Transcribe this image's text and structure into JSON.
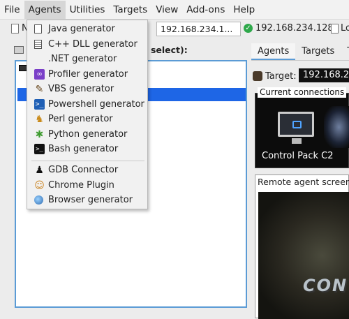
{
  "menubar": {
    "items": [
      {
        "label": "File"
      },
      {
        "label": "Agents"
      },
      {
        "label": "Utilities"
      },
      {
        "label": "Targets"
      },
      {
        "label": "View"
      },
      {
        "label": "Add-ons"
      },
      {
        "label": "Help"
      }
    ],
    "active": "Agents"
  },
  "toolbar": {
    "truncated_label": "N",
    "host_label": "o:",
    "host_value": "192.168.234.1...",
    "connected_ip": "192.168.234.128",
    "log_label": "Lo"
  },
  "left_panel": {
    "header": "o select):"
  },
  "right_panel": {
    "tabs": [
      {
        "label": "Agents"
      },
      {
        "label": "Targets"
      },
      {
        "label": "T"
      }
    ],
    "target_label": "Target:",
    "target_value": "192.168.234",
    "connections_title": "Current connections",
    "connection_name": "Control Pack C2",
    "screenshot_title": "Remote agent screensh",
    "screenshot_text": "CON"
  },
  "dropdown": {
    "items": [
      {
        "label": "Java generator",
        "icon": "java-file-icon"
      },
      {
        "label": "C++ DLL generator",
        "icon": "dll-file-icon"
      },
      {
        "label": ".NET generator",
        "icon": "windows-logo-icon"
      },
      {
        "label": "Profiler generator",
        "icon": "visual-studio-icon"
      },
      {
        "label": "VBS generator",
        "icon": "script-wand-icon"
      },
      {
        "label": "Powershell generator",
        "icon": "powershell-icon"
      },
      {
        "label": "Perl generator",
        "icon": "camel-icon"
      },
      {
        "label": "Python generator",
        "icon": "bug-icon"
      },
      {
        "label": "Bash generator",
        "icon": "terminal-icon"
      },
      {
        "label": "GDB Connector",
        "icon": "linux-penguin-icon"
      },
      {
        "label": "Chrome Plugin",
        "icon": "user-icon"
      },
      {
        "label": "Browser generator",
        "icon": "globe-icon"
      }
    ]
  },
  "colors": {
    "selection": "#1e66e6",
    "panel_border": "#5b9bd5",
    "connected": "#2ea84a"
  }
}
